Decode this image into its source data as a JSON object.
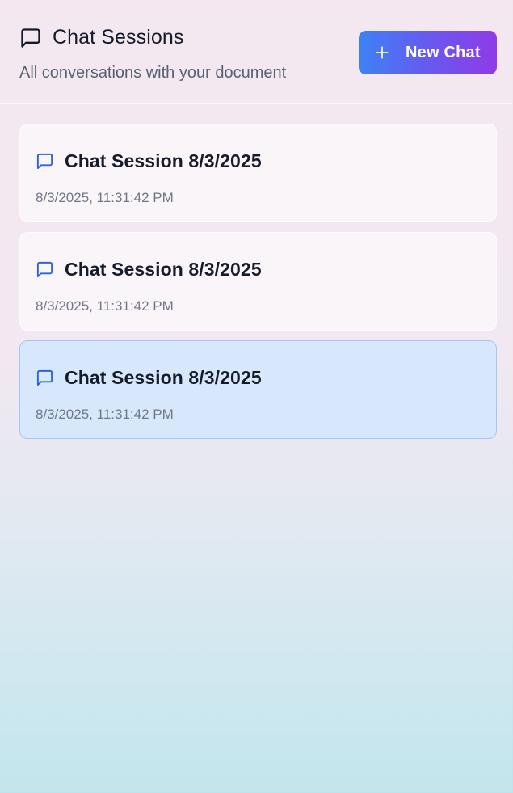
{
  "header": {
    "title": "Chat Sessions",
    "subtitle": "All conversations with your document",
    "new_chat_label": "New Chat"
  },
  "icons": {
    "header": "message-square-icon",
    "new_chat": "plus-icon",
    "session": "message-square-icon"
  },
  "colors": {
    "accent_start": "#3d82f5",
    "accent_end": "#8f3be6",
    "icon_blue": "#2f63d6",
    "active_bg": "#d7e8fc"
  },
  "sessions": [
    {
      "name": "Chat Session 8/3/2025",
      "timestamp": "8/3/2025, 11:31:42 PM",
      "active": false
    },
    {
      "name": "Chat Session 8/3/2025",
      "timestamp": "8/3/2025, 11:31:42 PM",
      "active": false
    },
    {
      "name": "Chat Session 8/3/2025",
      "timestamp": "8/3/2025, 11:31:42 PM",
      "active": true
    }
  ]
}
